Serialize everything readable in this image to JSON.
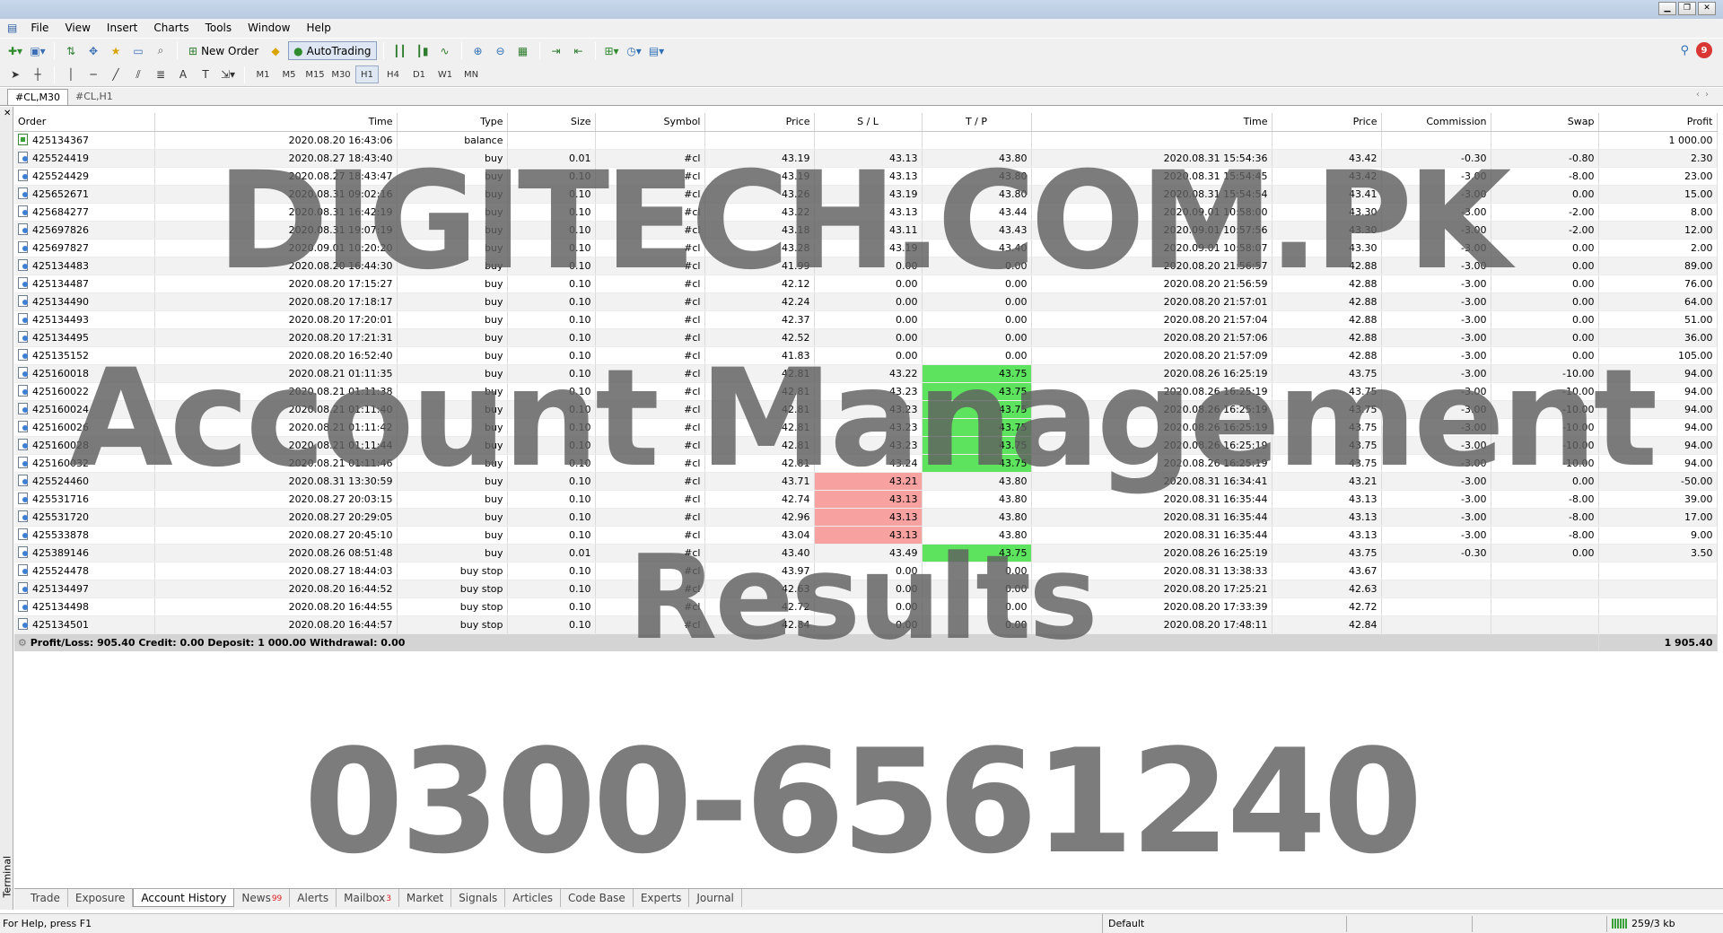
{
  "menu": {
    "items": [
      "File",
      "View",
      "Insert",
      "Charts",
      "Tools",
      "Window",
      "Help"
    ]
  },
  "toolbar": {
    "new_order_label": "New Order",
    "autotrading_label": "AutoTrading",
    "timeframes": [
      "M1",
      "M5",
      "M15",
      "M30",
      "H1",
      "H4",
      "D1",
      "W1",
      "MN"
    ],
    "active_timeframe": "H1",
    "notification_count": "9"
  },
  "chart_tabs": [
    "#CL,M30",
    "#CL,H1"
  ],
  "table": {
    "columns": [
      "Order",
      "Time",
      "Type",
      "Size",
      "Symbol",
      "Price",
      "S / L",
      "T / P",
      "Time",
      "Price",
      "Commission",
      "Swap",
      "Profit"
    ],
    "rows": [
      {
        "order": "425134367",
        "time": "2020.08.20 16:43:06",
        "type": "balance",
        "size": "",
        "symbol": "",
        "price": "",
        "sl": "",
        "tp": "",
        "ctime": "",
        "cprice": "",
        "commission": "",
        "swap": "",
        "profit": "1 000.00",
        "sl_hl": "",
        "tp_hl": "",
        "icon": "balance"
      },
      {
        "order": "425524419",
        "time": "2020.08.27 18:43:40",
        "type": "buy",
        "size": "0.01",
        "symbol": "#cl",
        "price": "43.19",
        "sl": "43.13",
        "tp": "43.80",
        "ctime": "2020.08.31 15:54:36",
        "cprice": "43.42",
        "commission": "-0.30",
        "swap": "-0.80",
        "profit": "2.30",
        "sl_hl": "",
        "tp_hl": "",
        "icon": "order"
      },
      {
        "order": "425524429",
        "time": "2020.08.27 18:43:47",
        "type": "buy",
        "size": "0.10",
        "symbol": "#cl",
        "price": "43.19",
        "sl": "43.13",
        "tp": "43.80",
        "ctime": "2020.08.31 15:54:45",
        "cprice": "43.42",
        "commission": "-3.00",
        "swap": "-8.00",
        "profit": "23.00",
        "sl_hl": "",
        "tp_hl": "",
        "icon": "order"
      },
      {
        "order": "425652671",
        "time": "2020.08.31 09:02:16",
        "type": "buy",
        "size": "0.10",
        "symbol": "#cl",
        "price": "43.26",
        "sl": "43.19",
        "tp": "43.80",
        "ctime": "2020.08.31 15:54:54",
        "cprice": "43.41",
        "commission": "-3.00",
        "swap": "0.00",
        "profit": "15.00",
        "sl_hl": "",
        "tp_hl": "",
        "icon": "order"
      },
      {
        "order": "425684277",
        "time": "2020.08.31 16:42:19",
        "type": "buy",
        "size": "0.10",
        "symbol": "#cl",
        "price": "43.22",
        "sl": "43.13",
        "tp": "43.44",
        "ctime": "2020.09.01 10:58:00",
        "cprice": "43.30",
        "commission": "-3.00",
        "swap": "-2.00",
        "profit": "8.00",
        "sl_hl": "",
        "tp_hl": "",
        "icon": "order"
      },
      {
        "order": "425697826",
        "time": "2020.08.31 19:07:19",
        "type": "buy",
        "size": "0.10",
        "symbol": "#cl",
        "price": "43.18",
        "sl": "43.11",
        "tp": "43.43",
        "ctime": "2020.09.01 10:57:56",
        "cprice": "43.30",
        "commission": "-3.00",
        "swap": "-2.00",
        "profit": "12.00",
        "sl_hl": "",
        "tp_hl": "",
        "icon": "order"
      },
      {
        "order": "425697827",
        "time": "2020.09.01 10:20:20",
        "type": "buy",
        "size": "0.10",
        "symbol": "#cl",
        "price": "43.28",
        "sl": "43.19",
        "tp": "43.40",
        "ctime": "2020.09.01 10:58:07",
        "cprice": "43.30",
        "commission": "-3.00",
        "swap": "0.00",
        "profit": "2.00",
        "sl_hl": "",
        "tp_hl": "",
        "icon": "order"
      },
      {
        "order": "425134483",
        "time": "2020.08.20 16:44:30",
        "type": "buy",
        "size": "0.10",
        "symbol": "#cl",
        "price": "41.99",
        "sl": "0.00",
        "tp": "0.00",
        "ctime": "2020.08.20 21:56:57",
        "cprice": "42.88",
        "commission": "-3.00",
        "swap": "0.00",
        "profit": "89.00",
        "sl_hl": "",
        "tp_hl": "",
        "icon": "order"
      },
      {
        "order": "425134487",
        "time": "2020.08.20 17:15:27",
        "type": "buy",
        "size": "0.10",
        "symbol": "#cl",
        "price": "42.12",
        "sl": "0.00",
        "tp": "0.00",
        "ctime": "2020.08.20 21:56:59",
        "cprice": "42.88",
        "commission": "-3.00",
        "swap": "0.00",
        "profit": "76.00",
        "sl_hl": "",
        "tp_hl": "",
        "icon": "order"
      },
      {
        "order": "425134490",
        "time": "2020.08.20 17:18:17",
        "type": "buy",
        "size": "0.10",
        "symbol": "#cl",
        "price": "42.24",
        "sl": "0.00",
        "tp": "0.00",
        "ctime": "2020.08.20 21:57:01",
        "cprice": "42.88",
        "commission": "-3.00",
        "swap": "0.00",
        "profit": "64.00",
        "sl_hl": "",
        "tp_hl": "",
        "icon": "order"
      },
      {
        "order": "425134493",
        "time": "2020.08.20 17:20:01",
        "type": "buy",
        "size": "0.10",
        "symbol": "#cl",
        "price": "42.37",
        "sl": "0.00",
        "tp": "0.00",
        "ctime": "2020.08.20 21:57:04",
        "cprice": "42.88",
        "commission": "-3.00",
        "swap": "0.00",
        "profit": "51.00",
        "sl_hl": "",
        "tp_hl": "",
        "icon": "order"
      },
      {
        "order": "425134495",
        "time": "2020.08.20 17:21:31",
        "type": "buy",
        "size": "0.10",
        "symbol": "#cl",
        "price": "42.52",
        "sl": "0.00",
        "tp": "0.00",
        "ctime": "2020.08.20 21:57:06",
        "cprice": "42.88",
        "commission": "-3.00",
        "swap": "0.00",
        "profit": "36.00",
        "sl_hl": "",
        "tp_hl": "",
        "icon": "order"
      },
      {
        "order": "425135152",
        "time": "2020.08.20 16:52:40",
        "type": "buy",
        "size": "0.10",
        "symbol": "#cl",
        "price": "41.83",
        "sl": "0.00",
        "tp": "0.00",
        "ctime": "2020.08.20 21:57:09",
        "cprice": "42.88",
        "commission": "-3.00",
        "swap": "0.00",
        "profit": "105.00",
        "sl_hl": "",
        "tp_hl": "",
        "icon": "order"
      },
      {
        "order": "425160018",
        "time": "2020.08.21 01:11:35",
        "type": "buy",
        "size": "0.10",
        "symbol": "#cl",
        "price": "42.81",
        "sl": "43.22",
        "tp": "43.75",
        "ctime": "2020.08.26 16:25:19",
        "cprice": "43.75",
        "commission": "-3.00",
        "swap": "-10.00",
        "profit": "94.00",
        "sl_hl": "",
        "tp_hl": "green",
        "icon": "order"
      },
      {
        "order": "425160022",
        "time": "2020.08.21 01:11:38",
        "type": "buy",
        "size": "0.10",
        "symbol": "#cl",
        "price": "42.81",
        "sl": "43.23",
        "tp": "43.75",
        "ctime": "2020.08.26 16:25:19",
        "cprice": "43.75",
        "commission": "-3.00",
        "swap": "-10.00",
        "profit": "94.00",
        "sl_hl": "",
        "tp_hl": "green",
        "icon": "order"
      },
      {
        "order": "425160024",
        "time": "2020.08.21 01:11:40",
        "type": "buy",
        "size": "0.10",
        "symbol": "#cl",
        "price": "42.81",
        "sl": "43.23",
        "tp": "43.75",
        "ctime": "2020.08.26 16:25:19",
        "cprice": "43.75",
        "commission": "-3.00",
        "swap": "-10.00",
        "profit": "94.00",
        "sl_hl": "",
        "tp_hl": "green",
        "icon": "order"
      },
      {
        "order": "425160026",
        "time": "2020.08.21 01:11:42",
        "type": "buy",
        "size": "0.10",
        "symbol": "#cl",
        "price": "42.81",
        "sl": "43.23",
        "tp": "43.75",
        "ctime": "2020.08.26 16:25:19",
        "cprice": "43.75",
        "commission": "-3.00",
        "swap": "-10.00",
        "profit": "94.00",
        "sl_hl": "",
        "tp_hl": "green",
        "icon": "order"
      },
      {
        "order": "425160028",
        "time": "2020.08.21 01:11:44",
        "type": "buy",
        "size": "0.10",
        "symbol": "#cl",
        "price": "42.81",
        "sl": "43.23",
        "tp": "43.75",
        "ctime": "2020.08.26 16:25:19",
        "cprice": "43.75",
        "commission": "-3.00",
        "swap": "-10.00",
        "profit": "94.00",
        "sl_hl": "",
        "tp_hl": "green",
        "icon": "order"
      },
      {
        "order": "425160032",
        "time": "2020.08.21 01:11:46",
        "type": "buy",
        "size": "0.10",
        "symbol": "#cl",
        "price": "42.81",
        "sl": "43.24",
        "tp": "43.75",
        "ctime": "2020.08.26 16:25:19",
        "cprice": "43.75",
        "commission": "-3.00",
        "swap": "-10.00",
        "profit": "94.00",
        "sl_hl": "",
        "tp_hl": "green",
        "icon": "order"
      },
      {
        "order": "425524460",
        "time": "2020.08.31 13:30:59",
        "type": "buy",
        "size": "0.10",
        "symbol": "#cl",
        "price": "43.71",
        "sl": "43.21",
        "tp": "43.80",
        "ctime": "2020.08.31 16:34:41",
        "cprice": "43.21",
        "commission": "-3.00",
        "swap": "0.00",
        "profit": "-50.00",
        "sl_hl": "red",
        "tp_hl": "",
        "icon": "order"
      },
      {
        "order": "425531716",
        "time": "2020.08.27 20:03:15",
        "type": "buy",
        "size": "0.10",
        "symbol": "#cl",
        "price": "42.74",
        "sl": "43.13",
        "tp": "43.80",
        "ctime": "2020.08.31 16:35:44",
        "cprice": "43.13",
        "commission": "-3.00",
        "swap": "-8.00",
        "profit": "39.00",
        "sl_hl": "red",
        "tp_hl": "",
        "icon": "order"
      },
      {
        "order": "425531720",
        "time": "2020.08.27 20:29:05",
        "type": "buy",
        "size": "0.10",
        "symbol": "#cl",
        "price": "42.96",
        "sl": "43.13",
        "tp": "43.80",
        "ctime": "2020.08.31 16:35:44",
        "cprice": "43.13",
        "commission": "-3.00",
        "swap": "-8.00",
        "profit": "17.00",
        "sl_hl": "red",
        "tp_hl": "",
        "icon": "order"
      },
      {
        "order": "425533878",
        "time": "2020.08.27 20:45:10",
        "type": "buy",
        "size": "0.10",
        "symbol": "#cl",
        "price": "43.04",
        "sl": "43.13",
        "tp": "43.80",
        "ctime": "2020.08.31 16:35:44",
        "cprice": "43.13",
        "commission": "-3.00",
        "swap": "-8.00",
        "profit": "9.00",
        "sl_hl": "red",
        "tp_hl": "",
        "icon": "order"
      },
      {
        "order": "425389146",
        "time": "2020.08.26 08:51:48",
        "type": "buy",
        "size": "0.01",
        "symbol": "#cl",
        "price": "43.40",
        "sl": "43.49",
        "tp": "43.75",
        "ctime": "2020.08.26 16:25:19",
        "cprice": "43.75",
        "commission": "-0.30",
        "swap": "0.00",
        "profit": "3.50",
        "sl_hl": "",
        "tp_hl": "green",
        "icon": "order"
      },
      {
        "order": "425524478",
        "time": "2020.08.27 18:44:03",
        "type": "buy stop",
        "size": "0.10",
        "symbol": "#cl",
        "price": "43.97",
        "sl": "0.00",
        "tp": "0.00",
        "ctime": "2020.08.31 13:38:33",
        "cprice": "43.67",
        "commission": "",
        "swap": "",
        "profit": "",
        "sl_hl": "",
        "tp_hl": "",
        "icon": "order"
      },
      {
        "order": "425134497",
        "time": "2020.08.20 16:44:52",
        "type": "buy stop",
        "size": "0.10",
        "symbol": "#cl",
        "price": "42.63",
        "sl": "0.00",
        "tp": "0.00",
        "ctime": "2020.08.20 17:25:21",
        "cprice": "42.63",
        "commission": "",
        "swap": "",
        "profit": "",
        "sl_hl": "",
        "tp_hl": "",
        "icon": "order"
      },
      {
        "order": "425134498",
        "time": "2020.08.20 16:44:55",
        "type": "buy stop",
        "size": "0.10",
        "symbol": "#cl",
        "price": "42.72",
        "sl": "0.00",
        "tp": "0.00",
        "ctime": "2020.08.20 17:33:39",
        "cprice": "42.72",
        "commission": "",
        "swap": "",
        "profit": "",
        "sl_hl": "",
        "tp_hl": "",
        "icon": "order"
      },
      {
        "order": "425134501",
        "time": "2020.08.20 16:44:57",
        "type": "buy stop",
        "size": "0.10",
        "symbol": "#cl",
        "price": "42.84",
        "sl": "0.00",
        "tp": "0.00",
        "ctime": "2020.08.20 17:48:11",
        "cprice": "42.84",
        "commission": "",
        "swap": "",
        "profit": "",
        "sl_hl": "",
        "tp_hl": "",
        "icon": "order"
      }
    ],
    "summary": {
      "text": "Profit/Loss: 905.40  Credit: 0.00  Deposit: 1 000.00  Withdrawal: 0.00",
      "total": "1 905.40"
    }
  },
  "watermark": {
    "line1": "DIGITECH.COM.PK",
    "line2": "Account Management",
    "line3": "Results",
    "phone": "0300-6561240"
  },
  "terminal": {
    "side_label": "Terminal",
    "tabs": [
      {
        "label": "Trade",
        "badge": ""
      },
      {
        "label": "Exposure",
        "badge": ""
      },
      {
        "label": "Account History",
        "badge": ""
      },
      {
        "label": "News",
        "badge": "99"
      },
      {
        "label": "Alerts",
        "badge": ""
      },
      {
        "label": "Mailbox",
        "badge": "3"
      },
      {
        "label": "Market",
        "badge": ""
      },
      {
        "label": "Signals",
        "badge": ""
      },
      {
        "label": "Articles",
        "badge": ""
      },
      {
        "label": "Code Base",
        "badge": ""
      },
      {
        "label": "Experts",
        "badge": ""
      },
      {
        "label": "Journal",
        "badge": ""
      }
    ],
    "active_tab": "Account History"
  },
  "status": {
    "help": "For Help, press F1",
    "profile": "Default",
    "traffic": "259/3 kb"
  },
  "colors": {
    "tp_hit": "#5de35d",
    "sl_hit": "#f7a1a1",
    "summary_bg": "#d4d4d4"
  }
}
